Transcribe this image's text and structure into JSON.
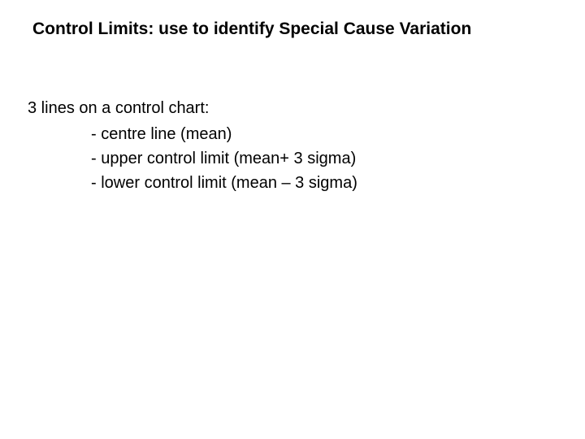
{
  "title": "Control Limits: use to identify Special Cause Variation",
  "intro": "3 lines on a control chart:",
  "bullets": {
    "b1": "- centre line (mean)",
    "b2": "- upper control limit (mean+ 3 sigma)",
    "b3": "- lower control limit (mean – 3 sigma)"
  }
}
